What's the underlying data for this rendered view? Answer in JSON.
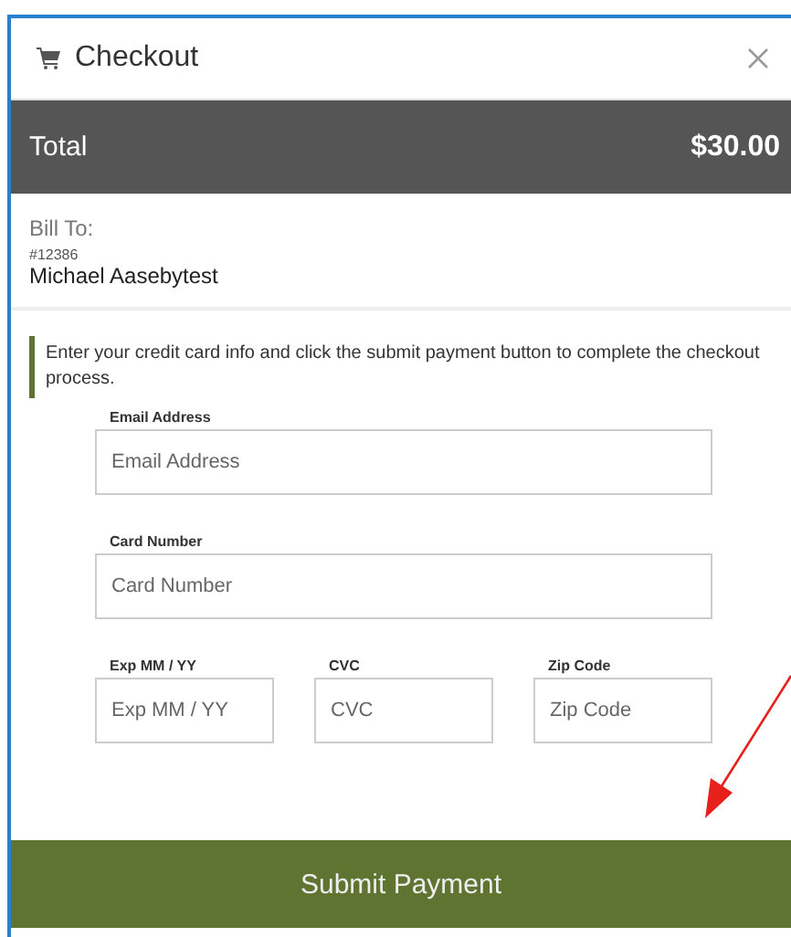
{
  "window": {
    "title": "Checkout"
  },
  "total": {
    "label": "Total",
    "amount": "$30.00"
  },
  "bill_to": {
    "heading": "Bill To:",
    "number": "#12386",
    "name": "Michael Aasebytest"
  },
  "notice": "Enter your credit card info and click the submit payment button to complete the checkout process.",
  "form": {
    "rows": [
      [
        {
          "label": "Email Address",
          "placeholder": "Email Address"
        }
      ],
      [
        {
          "label": "Card Number",
          "placeholder": "Card Number"
        }
      ],
      [
        {
          "label": "Exp MM / YY",
          "placeholder": "Exp MM / YY"
        },
        {
          "label": "CVC",
          "placeholder": "CVC"
        },
        {
          "label": "Zip Code",
          "placeholder": "Zip Code"
        }
      ]
    ]
  },
  "submit_button": "Submit Payment"
}
